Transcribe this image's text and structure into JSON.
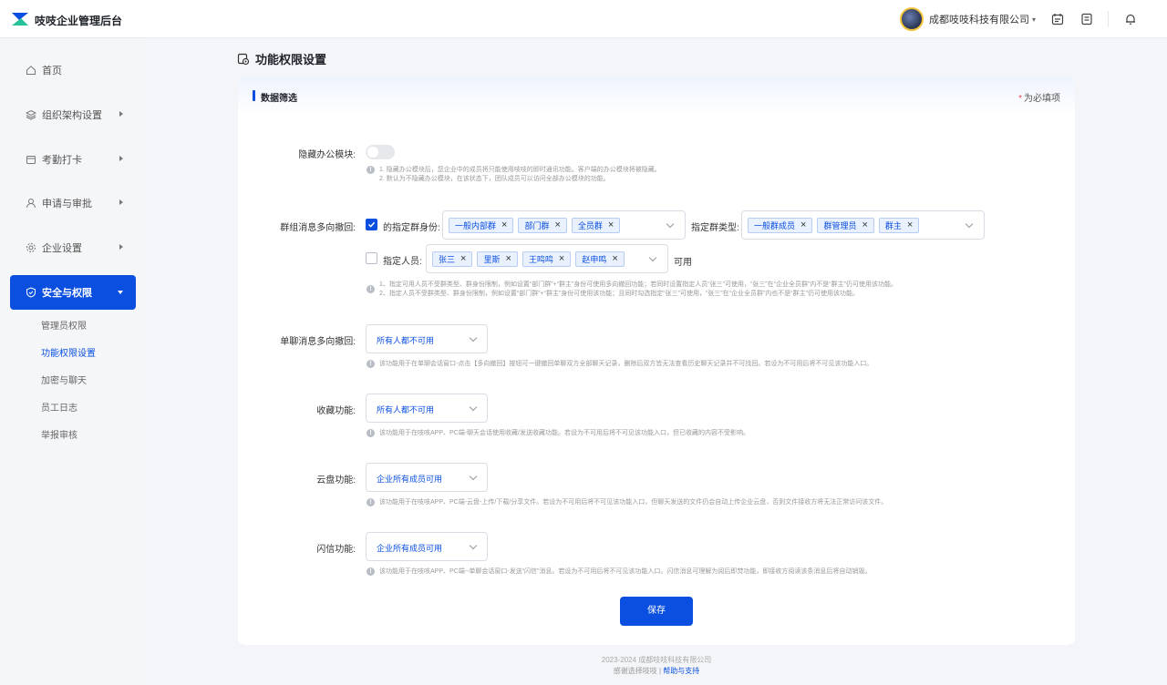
{
  "header": {
    "brand": "吱吱企业管理后台",
    "company": "成都吱吱科技有限公司",
    "accent": "#0a4fe0"
  },
  "sidebar": {
    "items": [
      {
        "label": "首页",
        "icon": "home-icon"
      },
      {
        "label": "组织架构设置",
        "icon": "layers-icon"
      },
      {
        "label": "考勤打卡",
        "icon": "calendar-icon"
      },
      {
        "label": "申请与审批",
        "icon": "user-icon"
      },
      {
        "label": "企业设置",
        "icon": "gear-icon"
      },
      {
        "label": "安全与权限",
        "icon": "shield-icon"
      }
    ],
    "sub_items": [
      "管理员权限",
      "功能权限设置",
      "加密与聊天",
      "员工日志",
      "举报审核"
    ]
  },
  "page": {
    "title": "功能权限设置",
    "section_title": "数据筛选",
    "required_mark": "*",
    "required_note": "为必填项"
  },
  "form": {
    "hide_office": {
      "label": "隐藏办公模块:",
      "enabled": false,
      "hint1": "1. 隐藏办公模块后，您企业中的成员将只能使用吱吱的即时通讯功能。客户端的办公模块将被隐藏。",
      "hint2": "2. 默认为不隐藏办公模块，在该状态下，团队成员可以访问全部办公模块的功能。"
    },
    "group_recall": {
      "label": "群组消息多向撤回:",
      "role_checkbox_label": "的指定群身份:",
      "roles": [
        "一般内部群",
        "部门群",
        "全员群"
      ],
      "group_type_label": "指定群类型:",
      "group_types": [
        "一般群成员",
        "群管理员",
        "群主"
      ],
      "person_checkbox_label": "指定人员:",
      "persons": [
        "张三",
        "里斯",
        "王鸣鸣",
        "赵申鸣"
      ],
      "available_text": "可用",
      "hint1": "1、指定可用人员不受群类型、群身份限制，例如设置“部门群”+“群主”身份可使用多向撤回功能；若同时设置指定人员“张三”可使用，“张三”在“企业全员群”内不是“群主”仍可使用该功能。",
      "hint2": "2、指定人员不受群类型、群身份限制，例如设置“部门群”+“群主”身份可使用该功能；且同时勾选指定“张三”可使用，“张三”在“企业全员群”内也不是“群主”仍可使用该功能。"
    },
    "single_recall": {
      "label": "单聊消息多向撤回:",
      "value": "所有人都不可用",
      "hint": "该功能用于在单聊会话窗口-点击【多向撤回】按钮可一键撤回单聊双方全部聊天记录，删除后双方皆无法查看历史聊天记录并不可找回。若设为不可用后将不可见该功能入口。"
    },
    "favorite": {
      "label": "收藏功能:",
      "value": "所有人都不可用",
      "hint": "该功能用于在吱吱APP、PC端-聊天会话使用收藏/发送收藏功能。若设为不可用后将不可见该功能入口，但已收藏的内容不受影响。"
    },
    "cloud": {
      "label": "云盘功能:",
      "value": "企业所有成员可用",
      "hint": "该功能用于在吱吱APP、PC端-云盘-上传/下载/分享文件。若设为不可用后将不可见该功能入口，但聊天发送的文件仍会自动上传企业云盘，否则文件接收方将无法正常访问该文件。"
    },
    "flash": {
      "label": "闪信功能:",
      "value": "企业所有成员可用",
      "hint": "该功能用于在吱吱APP、PC端--单聊会话窗口-发送“闪信”消息。若设为不可用后将不可见该功能入口。闪信消息可理解为阅后即焚功能，即接收方阅读该条消息后将自动销毁。"
    },
    "save_label": "保存"
  },
  "footer": {
    "copyright": "2023-2024 成都吱吱科技有限公司",
    "thanks": "感谢选择吱吱 |",
    "help": "帮助与支持"
  }
}
